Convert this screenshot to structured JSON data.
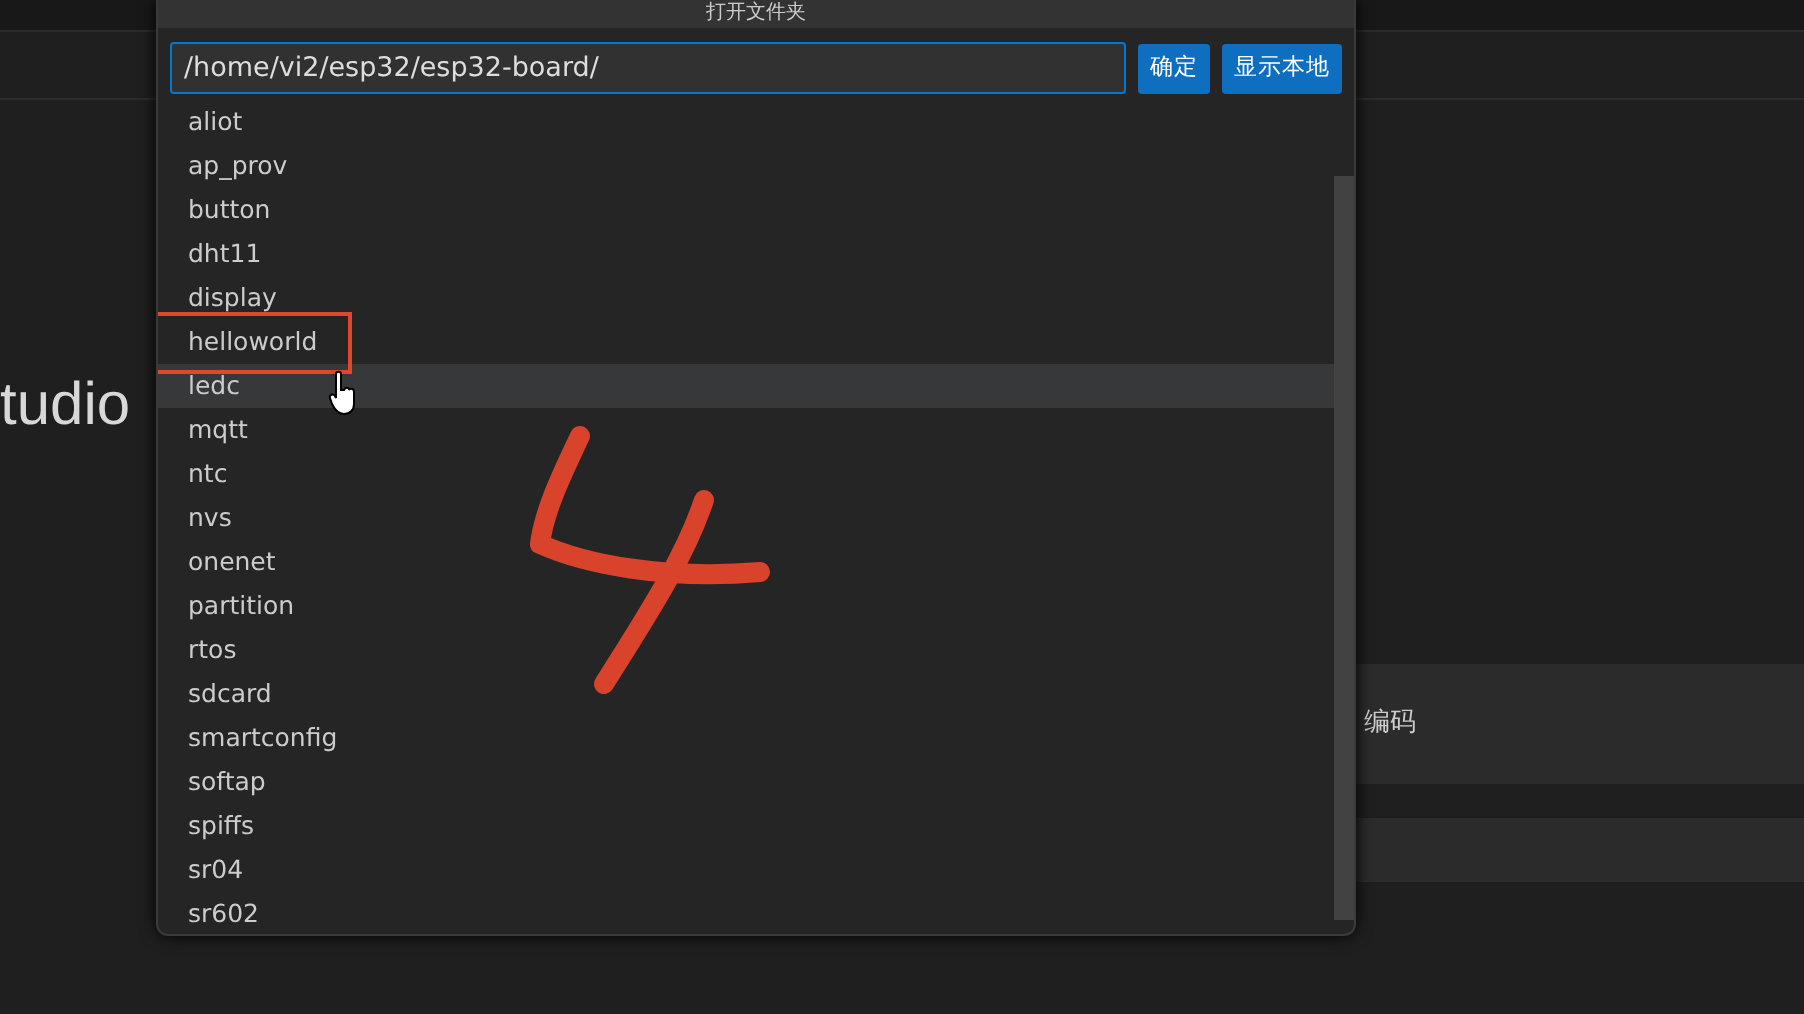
{
  "background": {
    "title_fragment": "tudio",
    "panel_text": "编码"
  },
  "dialog": {
    "title": "打开文件夹",
    "path": "/home/vi2/esp32/esp32-board/",
    "buttons": [
      "确定",
      "显示本地"
    ],
    "items": [
      {
        "label": "aliot",
        "hovered": false,
        "circled": false
      },
      {
        "label": "ap_prov",
        "hovered": false,
        "circled": false
      },
      {
        "label": "button",
        "hovered": false,
        "circled": false
      },
      {
        "label": "dht11",
        "hovered": false,
        "circled": false
      },
      {
        "label": "display",
        "hovered": false,
        "circled": false
      },
      {
        "label": "helloworld",
        "hovered": false,
        "circled": true
      },
      {
        "label": "ledc",
        "hovered": true,
        "circled": false
      },
      {
        "label": "mqtt",
        "hovered": false,
        "circled": false
      },
      {
        "label": "ntc",
        "hovered": false,
        "circled": false
      },
      {
        "label": "nvs",
        "hovered": false,
        "circled": false
      },
      {
        "label": "onenet",
        "hovered": false,
        "circled": false
      },
      {
        "label": "partition",
        "hovered": false,
        "circled": false
      },
      {
        "label": "rtos",
        "hovered": false,
        "circled": false
      },
      {
        "label": "sdcard",
        "hovered": false,
        "circled": false
      },
      {
        "label": "smartconfig",
        "hovered": false,
        "circled": false
      },
      {
        "label": "softap",
        "hovered": false,
        "circled": false
      },
      {
        "label": "spiffs",
        "hovered": false,
        "circled": false
      },
      {
        "label": "sr04",
        "hovered": false,
        "circled": false
      },
      {
        "label": "sr602",
        "hovered": false,
        "circled": false
      }
    ]
  }
}
